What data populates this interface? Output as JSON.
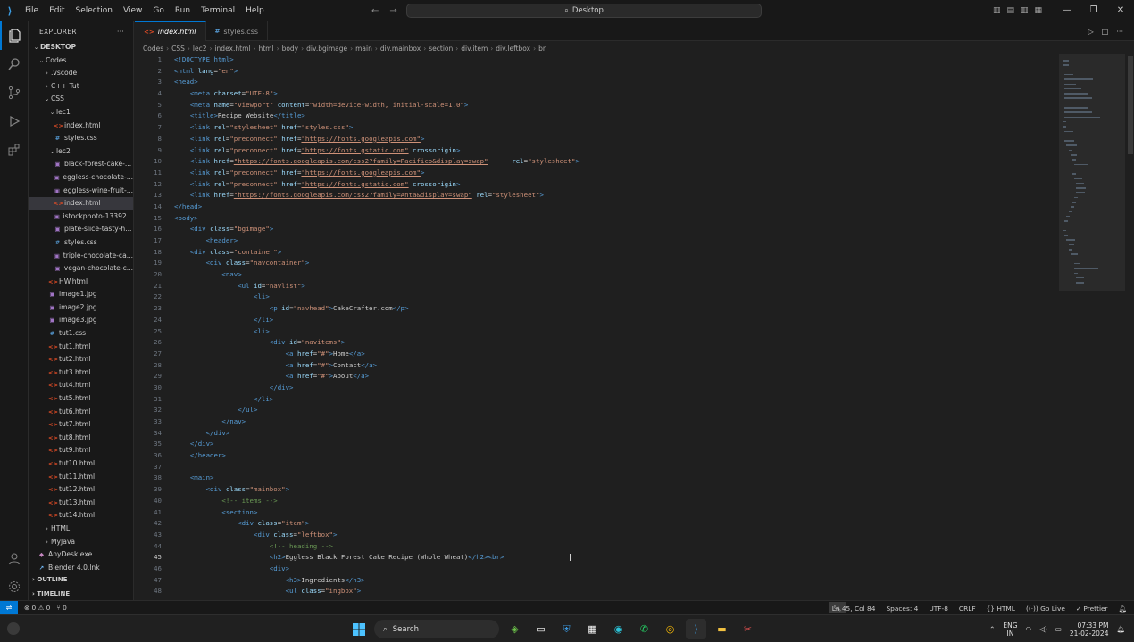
{
  "titlebar": {
    "menu": [
      "File",
      "Edit",
      "Selection",
      "View",
      "Go",
      "Run",
      "Terminal",
      "Help"
    ],
    "search_text": "Desktop"
  },
  "explorer": {
    "title": "EXPLORER",
    "items": [
      {
        "label": "DESKTOP",
        "depth": 0,
        "chev": "v",
        "kind": "root"
      },
      {
        "label": "Codes",
        "depth": 1,
        "chev": "v",
        "kind": "folder"
      },
      {
        "label": ".vscode",
        "depth": 2,
        "chev": ">",
        "kind": "folder"
      },
      {
        "label": "C++ Tut",
        "depth": 2,
        "chev": ">",
        "kind": "folder"
      },
      {
        "label": "CSS",
        "depth": 2,
        "chev": "v",
        "kind": "folder"
      },
      {
        "label": "lec1",
        "depth": 3,
        "chev": "v",
        "kind": "folder"
      },
      {
        "label": "index.html",
        "depth": 4,
        "kind": "html"
      },
      {
        "label": "styles.css",
        "depth": 4,
        "kind": "css"
      },
      {
        "label": "lec2",
        "depth": 3,
        "chev": "v",
        "kind": "folder"
      },
      {
        "label": "black-forest-cake-...",
        "depth": 4,
        "kind": "img"
      },
      {
        "label": "eggless-chocolate-...",
        "depth": 4,
        "kind": "img"
      },
      {
        "label": "eggless-wine-fruit-...",
        "depth": 4,
        "kind": "img"
      },
      {
        "label": "index.html",
        "depth": 4,
        "kind": "html",
        "selected": true
      },
      {
        "label": "istockphoto-13392...",
        "depth": 4,
        "kind": "img"
      },
      {
        "label": "plate-slice-tasty-h...",
        "depth": 4,
        "kind": "img"
      },
      {
        "label": "styles.css",
        "depth": 4,
        "kind": "css"
      },
      {
        "label": "triple-chocolate-ca...",
        "depth": 4,
        "kind": "img"
      },
      {
        "label": "vegan-chocolate-c...",
        "depth": 4,
        "kind": "img"
      },
      {
        "label": "HW.html",
        "depth": 3,
        "kind": "html"
      },
      {
        "label": "image1.jpg",
        "depth": 3,
        "kind": "img"
      },
      {
        "label": "image2.jpg",
        "depth": 3,
        "kind": "img"
      },
      {
        "label": "image3.jpg",
        "depth": 3,
        "kind": "img"
      },
      {
        "label": "tut1.css",
        "depth": 3,
        "kind": "css"
      },
      {
        "label": "tut1.html",
        "depth": 3,
        "kind": "html"
      },
      {
        "label": "tut2.html",
        "depth": 3,
        "kind": "html"
      },
      {
        "label": "tut3.html",
        "depth": 3,
        "kind": "html"
      },
      {
        "label": "tut4.html",
        "depth": 3,
        "kind": "html"
      },
      {
        "label": "tut5.html",
        "depth": 3,
        "kind": "html"
      },
      {
        "label": "tut6.html",
        "depth": 3,
        "kind": "html"
      },
      {
        "label": "tut7.html",
        "depth": 3,
        "kind": "html"
      },
      {
        "label": "tut8.html",
        "depth": 3,
        "kind": "html"
      },
      {
        "label": "tut9.html",
        "depth": 3,
        "kind": "html"
      },
      {
        "label": "tut10.html",
        "depth": 3,
        "kind": "html"
      },
      {
        "label": "tut11.html",
        "depth": 3,
        "kind": "html"
      },
      {
        "label": "tut12.html",
        "depth": 3,
        "kind": "html"
      },
      {
        "label": "tut13.html",
        "depth": 3,
        "kind": "html"
      },
      {
        "label": "tut14.html",
        "depth": 3,
        "kind": "html"
      },
      {
        "label": "HTML",
        "depth": 2,
        "chev": ">",
        "kind": "folder"
      },
      {
        "label": "MyJava",
        "depth": 2,
        "chev": ">",
        "kind": "folder"
      },
      {
        "label": "AnyDesk.exe",
        "depth": 1,
        "kind": "exe"
      },
      {
        "label": "Blender 4.0.lnk",
        "depth": 1,
        "kind": "lnk"
      }
    ],
    "outline_label": "OUTLINE",
    "timeline_label": "TIMELINE"
  },
  "tabs": [
    {
      "label": "index.html",
      "icon": "<>",
      "active": true
    },
    {
      "label": "styles.css",
      "icon": "#",
      "active": false
    }
  ],
  "breadcrumb": [
    "Codes",
    "CSS",
    "lec2",
    "index.html",
    "html",
    "body",
    "div.bgimage",
    "main",
    "div.mainbox",
    "section",
    "div.item",
    "div.leftbox",
    "br"
  ],
  "editor": {
    "current_line": 45,
    "lines": [
      [
        [
          "doc",
          "<!DOCTYPE html>"
        ]
      ],
      [
        [
          "tag",
          "<html "
        ],
        [
          "attr",
          "lang"
        ],
        [
          "src",
          "="
        ],
        [
          "val",
          "\"en\""
        ],
        [
          "tag",
          ">"
        ]
      ],
      [
        [
          "tag",
          "<head>"
        ]
      ],
      [
        [
          "src",
          "    "
        ],
        [
          "tag",
          "<meta "
        ],
        [
          "attr",
          "charset"
        ],
        [
          "src",
          "="
        ],
        [
          "val",
          "\"UTF-8\""
        ],
        [
          "tag",
          ">"
        ]
      ],
      [
        [
          "src",
          "    "
        ],
        [
          "tag",
          "<meta "
        ],
        [
          "attr",
          "name"
        ],
        [
          "src",
          "="
        ],
        [
          "val",
          "\"viewport\" "
        ],
        [
          "attr",
          "content"
        ],
        [
          "src",
          "="
        ],
        [
          "val",
          "\"width=device-width, initial-scale=1.0\""
        ],
        [
          "tag",
          ">"
        ]
      ],
      [
        [
          "src",
          "    "
        ],
        [
          "tag",
          "<title>"
        ],
        [
          "src",
          "Recipe Website"
        ],
        [
          "tag",
          "</title>"
        ]
      ],
      [
        [
          "src",
          "    "
        ],
        [
          "tag",
          "<link "
        ],
        [
          "attr",
          "rel"
        ],
        [
          "src",
          "="
        ],
        [
          "val",
          "\"stylesheet\" "
        ],
        [
          "attr",
          "href"
        ],
        [
          "src",
          "="
        ],
        [
          "val",
          "\"styles.css\""
        ],
        [
          "tag",
          ">"
        ]
      ],
      [
        [
          "src",
          "    "
        ],
        [
          "tag",
          "<link "
        ],
        [
          "attr",
          "rel"
        ],
        [
          "src",
          "="
        ],
        [
          "val",
          "\"preconnect\" "
        ],
        [
          "attr",
          "href"
        ],
        [
          "src",
          "="
        ],
        [
          "link",
          "\"https://fonts.googleapis.com\""
        ],
        [
          "tag",
          ">"
        ]
      ],
      [
        [
          "src",
          "    "
        ],
        [
          "tag",
          "<link "
        ],
        [
          "attr",
          "rel"
        ],
        [
          "src",
          "="
        ],
        [
          "val",
          "\"preconnect\" "
        ],
        [
          "attr",
          "href"
        ],
        [
          "src",
          "="
        ],
        [
          "link",
          "\"https://fonts.gstatic.com\""
        ],
        [
          "attr",
          " crossorigin"
        ],
        [
          "tag",
          ">"
        ]
      ],
      [
        [
          "src",
          "    "
        ],
        [
          "tag",
          "<link "
        ],
        [
          "attr",
          "href"
        ],
        [
          "src",
          "="
        ],
        [
          "link",
          "\"https://fonts.googleapis.com/css2?family=Pacifico&display=swap\""
        ],
        [
          "src",
          "      "
        ],
        [
          "attr",
          "rel"
        ],
        [
          "src",
          "="
        ],
        [
          "val",
          "\"stylesheet\""
        ],
        [
          "tag",
          ">"
        ]
      ],
      [
        [
          "src",
          "    "
        ],
        [
          "tag",
          "<link "
        ],
        [
          "attr",
          "rel"
        ],
        [
          "src",
          "="
        ],
        [
          "val",
          "\"preconnect\" "
        ],
        [
          "attr",
          "href"
        ],
        [
          "src",
          "="
        ],
        [
          "link",
          "\"https://fonts.googleapis.com\""
        ],
        [
          "tag",
          ">"
        ]
      ],
      [
        [
          "src",
          "    "
        ],
        [
          "tag",
          "<link "
        ],
        [
          "attr",
          "rel"
        ],
        [
          "src",
          "="
        ],
        [
          "val",
          "\"preconnect\" "
        ],
        [
          "attr",
          "href"
        ],
        [
          "src",
          "="
        ],
        [
          "link",
          "\"https://fonts.gstatic.com\""
        ],
        [
          "attr",
          " crossorigin"
        ],
        [
          "tag",
          ">"
        ]
      ],
      [
        [
          "src",
          "    "
        ],
        [
          "tag",
          "<link "
        ],
        [
          "attr",
          "href"
        ],
        [
          "src",
          "="
        ],
        [
          "link",
          "\"https://fonts.googleapis.com/css2?family=Anta&display=swap\""
        ],
        [
          "attr",
          " rel"
        ],
        [
          "src",
          "="
        ],
        [
          "val",
          "\"stylesheet\""
        ],
        [
          "tag",
          ">"
        ]
      ],
      [
        [
          "tag",
          "</head>"
        ]
      ],
      [
        [
          "tag",
          "<body>"
        ]
      ],
      [
        [
          "src",
          "    "
        ],
        [
          "tag",
          "<div "
        ],
        [
          "attr",
          "class"
        ],
        [
          "src",
          "="
        ],
        [
          "val",
          "\"bgimage\""
        ],
        [
          "tag",
          ">"
        ]
      ],
      [
        [
          "src",
          "        "
        ],
        [
          "tag",
          "<header>"
        ]
      ],
      [
        [
          "src",
          "    "
        ],
        [
          "tag",
          "<div "
        ],
        [
          "attr",
          "class"
        ],
        [
          "src",
          "="
        ],
        [
          "val",
          "\"container\""
        ],
        [
          "tag",
          ">"
        ]
      ],
      [
        [
          "src",
          "        "
        ],
        [
          "tag",
          "<div "
        ],
        [
          "attr",
          "class"
        ],
        [
          "src",
          "="
        ],
        [
          "val",
          "\"navcontainer\""
        ],
        [
          "tag",
          ">"
        ]
      ],
      [
        [
          "src",
          "            "
        ],
        [
          "tag",
          "<nav>"
        ]
      ],
      [
        [
          "src",
          "                "
        ],
        [
          "tag",
          "<ul "
        ],
        [
          "attr",
          "id"
        ],
        [
          "src",
          "="
        ],
        [
          "val",
          "\"navlist\""
        ],
        [
          "tag",
          ">"
        ]
      ],
      [
        [
          "src",
          "                    "
        ],
        [
          "tag",
          "<li>"
        ]
      ],
      [
        [
          "src",
          "                        "
        ],
        [
          "tag",
          "<p "
        ],
        [
          "attr",
          "id"
        ],
        [
          "src",
          "="
        ],
        [
          "val",
          "\"navhead\""
        ],
        [
          "tag",
          ">"
        ],
        [
          "src",
          "CakeCrafter.com"
        ],
        [
          "tag",
          "</p>"
        ]
      ],
      [
        [
          "src",
          "                    "
        ],
        [
          "tag",
          "</li>"
        ]
      ],
      [
        [
          "src",
          "                    "
        ],
        [
          "tag",
          "<li>"
        ]
      ],
      [
        [
          "src",
          "                        "
        ],
        [
          "tag",
          "<div "
        ],
        [
          "attr",
          "id"
        ],
        [
          "src",
          "="
        ],
        [
          "val",
          "\"navitems\""
        ],
        [
          "tag",
          ">"
        ]
      ],
      [
        [
          "src",
          "                            "
        ],
        [
          "tag",
          "<a "
        ],
        [
          "attr",
          "href"
        ],
        [
          "src",
          "="
        ],
        [
          "val",
          "\"#\""
        ],
        [
          "tag",
          ">"
        ],
        [
          "src",
          "Home"
        ],
        [
          "tag",
          "</a>"
        ]
      ],
      [
        [
          "src",
          "                            "
        ],
        [
          "tag",
          "<a "
        ],
        [
          "attr",
          "href"
        ],
        [
          "src",
          "="
        ],
        [
          "val",
          "\"#\""
        ],
        [
          "tag",
          ">"
        ],
        [
          "src",
          "Contact"
        ],
        [
          "tag",
          "</a>"
        ]
      ],
      [
        [
          "src",
          "                            "
        ],
        [
          "tag",
          "<a "
        ],
        [
          "attr",
          "href"
        ],
        [
          "src",
          "="
        ],
        [
          "val",
          "\"#\""
        ],
        [
          "tag",
          ">"
        ],
        [
          "src",
          "About"
        ],
        [
          "tag",
          "</a>"
        ]
      ],
      [
        [
          "src",
          "                        "
        ],
        [
          "tag",
          "</div>"
        ]
      ],
      [
        [
          "src",
          "                    "
        ],
        [
          "tag",
          "</li>"
        ]
      ],
      [
        [
          "src",
          "                "
        ],
        [
          "tag",
          "</ul>"
        ]
      ],
      [
        [
          "src",
          "            "
        ],
        [
          "tag",
          "</nav>"
        ]
      ],
      [
        [
          "src",
          "        "
        ],
        [
          "tag",
          "</div>"
        ]
      ],
      [
        [
          "src",
          "    "
        ],
        [
          "tag",
          "</div>"
        ]
      ],
      [
        [
          "src",
          "    "
        ],
        [
          "tag",
          "</header>"
        ]
      ],
      [
        [
          "src",
          ""
        ]
      ],
      [
        [
          "src",
          "    "
        ],
        [
          "tag",
          "<main>"
        ]
      ],
      [
        [
          "src",
          "        "
        ],
        [
          "tag",
          "<div "
        ],
        [
          "attr",
          "class"
        ],
        [
          "src",
          "="
        ],
        [
          "val",
          "\"mainbox\""
        ],
        [
          "tag",
          ">"
        ]
      ],
      [
        [
          "src",
          "            "
        ],
        [
          "com",
          "<!-- items -->"
        ]
      ],
      [
        [
          "src",
          "            "
        ],
        [
          "tag",
          "<section>"
        ]
      ],
      [
        [
          "src",
          "                "
        ],
        [
          "tag",
          "<div "
        ],
        [
          "attr",
          "class"
        ],
        [
          "src",
          "="
        ],
        [
          "val",
          "\"item\""
        ],
        [
          "tag",
          ">"
        ]
      ],
      [
        [
          "src",
          "                    "
        ],
        [
          "tag",
          "<div "
        ],
        [
          "attr",
          "class"
        ],
        [
          "src",
          "="
        ],
        [
          "val",
          "\"leftbox\""
        ],
        [
          "tag",
          ">"
        ]
      ],
      [
        [
          "src",
          "                        "
        ],
        [
          "com",
          "<!-- heading -->"
        ]
      ],
      [
        [
          "src",
          "                        "
        ],
        [
          "tag",
          "<h2>"
        ],
        [
          "src",
          "Eggless Black Forest Cake Recipe (Whole Wheat)"
        ],
        [
          "tag",
          "</h2><br>"
        ]
      ],
      [
        [
          "src",
          "                        "
        ],
        [
          "tag",
          "<div>"
        ]
      ],
      [
        [
          "src",
          "                            "
        ],
        [
          "tag",
          "<h3>"
        ],
        [
          "src",
          "Ingredients"
        ],
        [
          "tag",
          "</h3>"
        ]
      ],
      [
        [
          "src",
          "                            "
        ],
        [
          "tag",
          "<ul "
        ],
        [
          "attr",
          "class"
        ],
        [
          "src",
          "="
        ],
        [
          "val",
          "\"ingbox\""
        ],
        [
          "tag",
          ">"
        ]
      ]
    ]
  },
  "statusbar": {
    "problems": "⊗ 0 ⚠ 0",
    "ports": "⑂ 0",
    "cursor_pos": "Ln 45, Col 84",
    "spaces": "Spaces: 4",
    "encoding": "UTF-8",
    "eol": "CRLF",
    "language": "HTML",
    "golive": "Go Live",
    "prettier": "✓ Prettier"
  },
  "taskbar": {
    "search_label": "Search",
    "lang_line1": "ENG",
    "lang_line2": "IN",
    "time": "07:33 PM",
    "date": "21-02-2024"
  }
}
